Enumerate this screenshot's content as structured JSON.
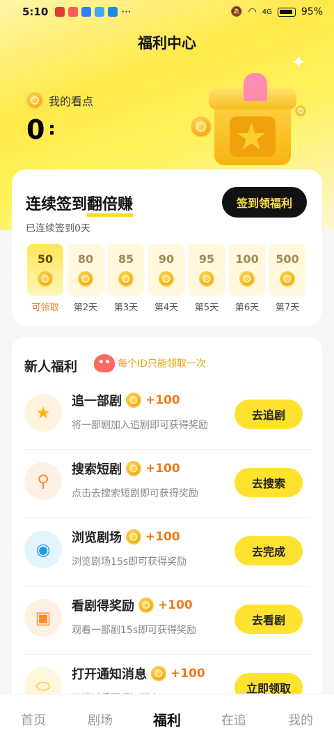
{
  "status": {
    "time": "5:10",
    "signal_label": "4G",
    "battery": "95%",
    "more": "···"
  },
  "header": {
    "title": "福利中心"
  },
  "points": {
    "label": "我的看点",
    "value": "0"
  },
  "checkin": {
    "title_prefix": "连续签到",
    "title_highlight": "翻倍赚",
    "subtitle": "已连续签到0天",
    "button": "签到领福利",
    "days": [
      {
        "amount": "50",
        "label": "可领取"
      },
      {
        "amount": "80",
        "label": "第2天"
      },
      {
        "amount": "85",
        "label": "第3天"
      },
      {
        "amount": "90",
        "label": "第4天"
      },
      {
        "amount": "95",
        "label": "第5天"
      },
      {
        "amount": "100",
        "label": "第6天"
      },
      {
        "amount": "500",
        "label": "第7天"
      }
    ]
  },
  "newbie": {
    "title": "新人福利",
    "note": "每个ID只能领取一次",
    "tasks": [
      {
        "name": "追一部剧",
        "reward": "+100",
        "desc": "将一部剧加入追剧即可获得奖励",
        "button": "去追剧",
        "icon": "star-icon"
      },
      {
        "name": "搜索短剧",
        "reward": "+100",
        "desc": "点击去搜索短剧即可获得奖励",
        "button": "去搜索",
        "icon": "search-icon"
      },
      {
        "name": "浏览剧场",
        "reward": "+100",
        "desc": "浏览剧场15s即可获得奖励",
        "button": "去完成",
        "icon": "eye-icon"
      },
      {
        "name": "看剧得奖励",
        "reward": "+100",
        "desc": "观看一部剧15s即可获得奖励",
        "button": "去看剧",
        "icon": "tv-icon"
      },
      {
        "name": "打开通知消息",
        "reward": "+100",
        "desc": "不错过重要通知消息",
        "button": "立即领取",
        "icon": "toggle-icon"
      }
    ]
  },
  "tabs": [
    {
      "label": "首页"
    },
    {
      "label": "剧场"
    },
    {
      "label": "福利"
    },
    {
      "label": "在追"
    },
    {
      "label": "我的"
    }
  ]
}
